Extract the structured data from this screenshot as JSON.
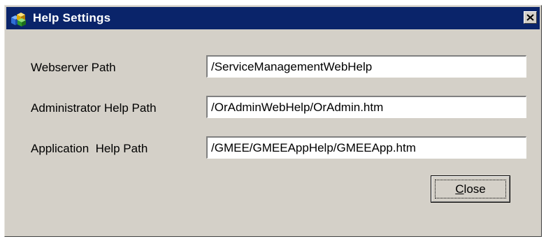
{
  "window": {
    "title": "Help Settings",
    "close_glyph": "×",
    "icon": "app-cubes-icon"
  },
  "form": {
    "rows": [
      {
        "label": "Webserver Path",
        "value": "/ServiceManagementWebHelp"
      },
      {
        "label": "Administrator Help Path",
        "value": "/OrAdminWebHelp/OrAdmin.htm"
      },
      {
        "label": "Application  Help Path",
        "value": "/GMEE/GMEEAppHelp/GMEEApp.htm"
      }
    ]
  },
  "buttons": {
    "close_mnemonic": "C",
    "close_rest": "lose"
  },
  "colors": {
    "titlebar": "#0a246a",
    "face": "#d4d0c8"
  }
}
